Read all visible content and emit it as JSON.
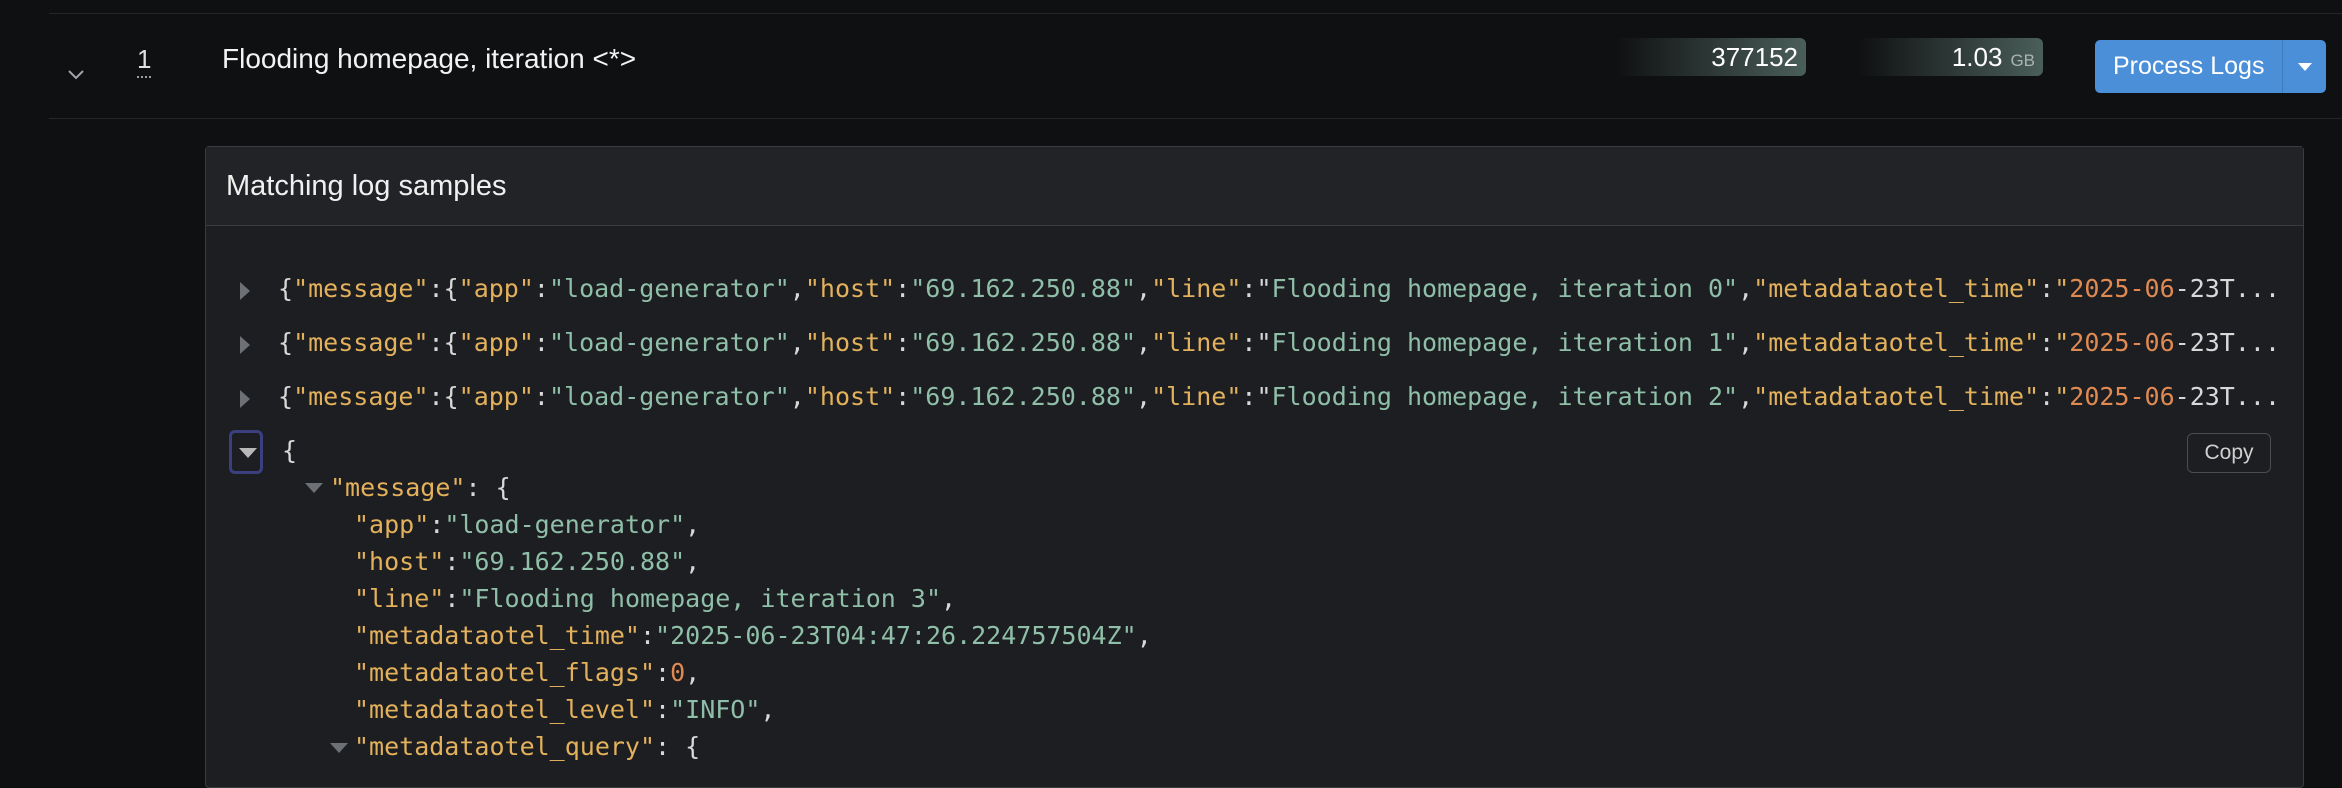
{
  "row": {
    "count": "1",
    "pattern": "Flooding homepage, iteration <*>",
    "events": "377152",
    "size_value": "1.03",
    "size_unit": "GB",
    "process_label": "Process Logs"
  },
  "panel": {
    "title": "Matching log samples",
    "copy_label": "Copy"
  },
  "samples": [
    {
      "line": "Flooding homepage, iteration 0"
    },
    {
      "line": "Flooding homepage, iteration 1"
    },
    {
      "line": "Flooding homepage, iteration 2"
    }
  ],
  "sample_common": {
    "k_message": "\"message\"",
    "k_app": "\"app\"",
    "v_app": "\"load-generator\"",
    "k_host": "\"host\"",
    "v_host": "\"69.162.250.88\"",
    "k_line": "\"line\"",
    "k_time": "\"metadataotel_time\"",
    "time_prefix": "\"",
    "time_num": "2025-06",
    "time_tail": "-23T..."
  },
  "expanded": {
    "open_brace": "{",
    "message_key": "\"message\"",
    "app_key": "\"app\"",
    "app_val": "\"load-generator\"",
    "host_key": "\"host\"",
    "host_val": "\"69.162.250.88\"",
    "line_key": "\"line\"",
    "line_val": "\"Flooding homepage, iteration 3\"",
    "time_key": "\"metadataotel_time\"",
    "time_val": "\"2025-06-23T04:47:26.224757504Z\"",
    "flags_key": "\"metadataotel_flags\"",
    "flags_val": "0",
    "level_key": "\"metadataotel_level\"",
    "level_val": "\"INFO\"",
    "query_key": "\"metadataotel_query\""
  },
  "colors": {
    "key": "#e3b15c",
    "string": "#8fbfa8",
    "number": "#e08a52",
    "button": "#4a8fd8"
  },
  "icons": {
    "row_toggle": "chevron-down-icon",
    "sample_toggle": "caret-right-icon",
    "expanded_toggle": "caret-down-icon",
    "button_caret": "caret-down-icon"
  }
}
